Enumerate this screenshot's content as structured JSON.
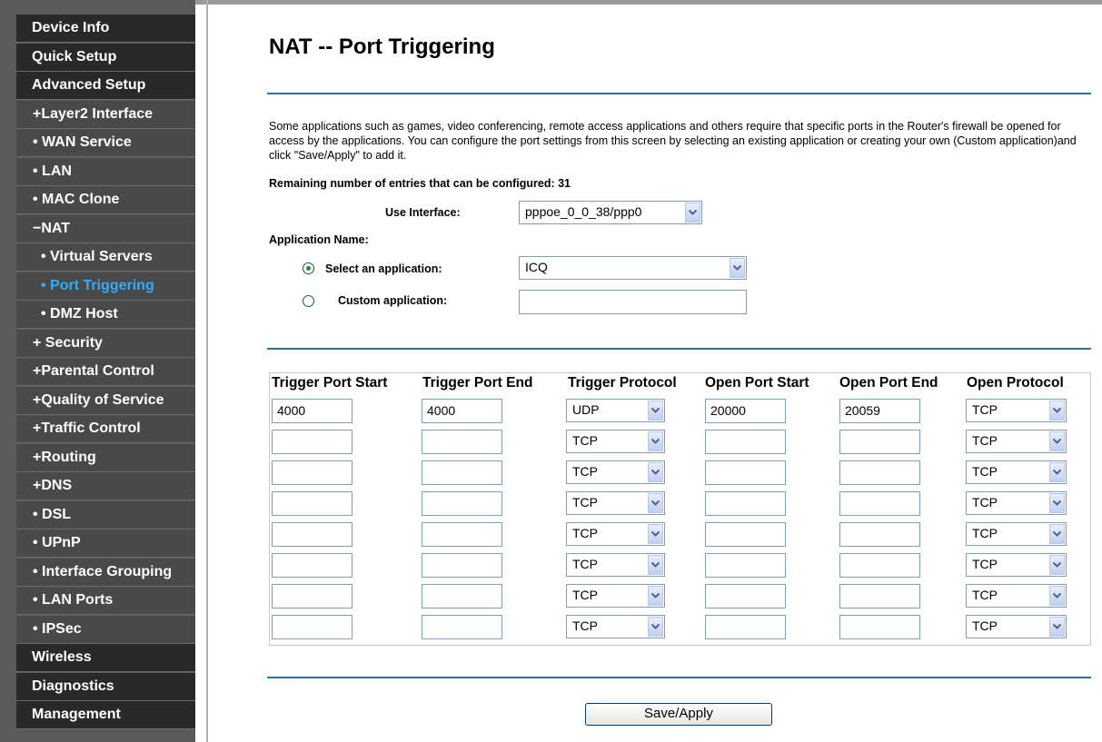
{
  "sidebar": {
    "items": [
      {
        "label": "Device Info",
        "level": "top"
      },
      {
        "label": "Quick Setup",
        "level": "top"
      },
      {
        "label": "Advanced Setup",
        "level": "top"
      },
      {
        "label": "+Layer2 Interface",
        "level": "sub"
      },
      {
        "label": "• WAN Service",
        "level": "sub"
      },
      {
        "label": "• LAN",
        "level": "sub"
      },
      {
        "label": "• MAC Clone",
        "level": "sub"
      },
      {
        "label": "−NAT",
        "level": "sub"
      },
      {
        "label": "• Virtual Servers",
        "level": "subsub"
      },
      {
        "label": "• Port Triggering",
        "level": "subsub",
        "active": true
      },
      {
        "label": "• DMZ Host",
        "level": "subsub"
      },
      {
        "label": "+ Security",
        "level": "sub"
      },
      {
        "label": "+Parental Control",
        "level": "sub"
      },
      {
        "label": "+Quality of Service",
        "level": "sub"
      },
      {
        "label": "+Traffic Control",
        "level": "sub"
      },
      {
        "label": "+Routing",
        "level": "sub"
      },
      {
        "label": "+DNS",
        "level": "sub"
      },
      {
        "label": "• DSL",
        "level": "sub"
      },
      {
        "label": "• UPnP",
        "level": "sub"
      },
      {
        "label": "• Interface Grouping",
        "level": "sub"
      },
      {
        "label": "• LAN Ports",
        "level": "sub"
      },
      {
        "label": "• IPSec",
        "level": "sub"
      },
      {
        "label": "Wireless",
        "level": "top"
      },
      {
        "label": "Diagnostics",
        "level": "top"
      },
      {
        "label": "Management",
        "level": "top"
      }
    ]
  },
  "page": {
    "title": "NAT -- Port Triggering",
    "description": "Some applications such as games, video conferencing, remote access applications and others require that specific ports in the Router's firewall be opened for access by the applications. You can configure the port settings from this screen by selecting an existing application or creating your own (Custom application)and click \"Save/Apply\" to add it.",
    "remaining": "Remaining number of entries that can be configured: 31",
    "use_interface_label": "Use Interface:",
    "use_interface_value": "pppoe_0_0_38/ppp0",
    "app_name_label": "Application Name:",
    "select_app_label": "Select an application:",
    "select_app_value": "ICQ",
    "custom_app_label": "Custom application:",
    "custom_app_value": "",
    "save_button": "Save/Apply"
  },
  "table": {
    "headers": [
      "Trigger Port Start",
      "Trigger Port End",
      "Trigger Protocol",
      "Open Port Start",
      "Open Port End",
      "Open Protocol"
    ],
    "rows": [
      {
        "trigger_start": "4000",
        "trigger_end": "4000",
        "trigger_proto": "UDP",
        "open_start": "20000",
        "open_end": "20059",
        "open_proto": "TCP"
      },
      {
        "trigger_start": "",
        "trigger_end": "",
        "trigger_proto": "TCP",
        "open_start": "",
        "open_end": "",
        "open_proto": "TCP"
      },
      {
        "trigger_start": "",
        "trigger_end": "",
        "trigger_proto": "TCP",
        "open_start": "",
        "open_end": "",
        "open_proto": "TCP"
      },
      {
        "trigger_start": "",
        "trigger_end": "",
        "trigger_proto": "TCP",
        "open_start": "",
        "open_end": "",
        "open_proto": "TCP"
      },
      {
        "trigger_start": "",
        "trigger_end": "",
        "trigger_proto": "TCP",
        "open_start": "",
        "open_end": "",
        "open_proto": "TCP"
      },
      {
        "trigger_start": "",
        "trigger_end": "",
        "trigger_proto": "TCP",
        "open_start": "",
        "open_end": "",
        "open_proto": "TCP"
      },
      {
        "trigger_start": "",
        "trigger_end": "",
        "trigger_proto": "TCP",
        "open_start": "",
        "open_end": "",
        "open_proto": "TCP"
      },
      {
        "trigger_start": "",
        "trigger_end": "",
        "trigger_proto": "TCP",
        "open_start": "",
        "open_end": "",
        "open_proto": "TCP"
      }
    ]
  },
  "colors": {
    "active_item": "#33aaff",
    "rule": "#2f6f9a"
  }
}
